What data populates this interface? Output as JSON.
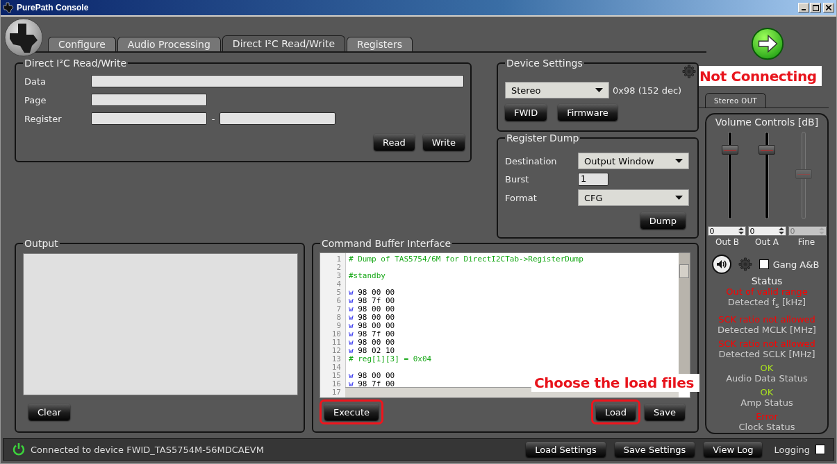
{
  "window": {
    "title": "PurePath Console"
  },
  "tabs": [
    {
      "label": "Configure",
      "selected": false
    },
    {
      "label": "Audio Processing",
      "selected": false
    },
    {
      "label": "Direct I²C Read/Write",
      "selected": true
    },
    {
      "label": "Registers",
      "selected": false
    }
  ],
  "direct_i2c": {
    "title": "Direct I²C Read/Write",
    "fields": [
      {
        "label": "Data",
        "kind": "wide"
      },
      {
        "label": "Page",
        "kind": "short"
      },
      {
        "label": "Register",
        "kind": "range"
      }
    ],
    "range_separator": "-",
    "buttons": [
      "Read",
      "Write"
    ]
  },
  "device_settings": {
    "title": "Device Settings",
    "mode": "Stereo",
    "address": "0x98 (152 dec)",
    "buttons": [
      "FWID",
      "Firmware"
    ]
  },
  "register_dump": {
    "title": "Register Dump",
    "rows": [
      {
        "label": "Destination",
        "kind": "dropdown",
        "value": "Output Window"
      },
      {
        "label": "Burst",
        "kind": "input",
        "value": "1"
      },
      {
        "label": "Format",
        "kind": "dropdown",
        "value": "CFG"
      }
    ],
    "button": "Dump"
  },
  "output": {
    "title": "Output",
    "button": "Clear"
  },
  "command_buffer": {
    "title": "Command Buffer Interface",
    "lines": [
      {
        "number": "1",
        "kind": "comment",
        "text": "# Dump of TAS5754/6M for DirectI2CTab->RegisterDump"
      },
      {
        "number": "2",
        "kind": "blank"
      },
      {
        "number": "3",
        "kind": "comment",
        "text": "#standby"
      },
      {
        "number": "4",
        "kind": "blank"
      },
      {
        "number": "5",
        "kind": "write",
        "op": "w",
        "text": "98 00 00"
      },
      {
        "number": "6",
        "kind": "write",
        "op": "w",
        "text": "98 7f 00"
      },
      {
        "number": "7",
        "kind": "write",
        "op": "w",
        "text": "98 00 00"
      },
      {
        "number": "8",
        "kind": "write",
        "op": "w",
        "text": "98 00 00"
      },
      {
        "number": "9",
        "kind": "write",
        "op": "w",
        "text": "98 00 00"
      },
      {
        "number": "10",
        "kind": "write",
        "op": "w",
        "text": "98 7f 00"
      },
      {
        "number": "11",
        "kind": "write",
        "op": "w",
        "text": "98 00 00"
      },
      {
        "number": "12",
        "kind": "write",
        "op": "w",
        "text": "98 02 10"
      },
      {
        "number": "13",
        "kind": "comment",
        "text": "# reg[1][3] = 0x04"
      },
      {
        "number": "14",
        "kind": "blank"
      },
      {
        "number": "15",
        "kind": "write",
        "op": "w",
        "text": "98 00 00"
      },
      {
        "number": "16",
        "kind": "write",
        "op": "w",
        "text": "98 7f 00"
      },
      {
        "number": "17",
        "kind": "blank"
      }
    ],
    "buttons": [
      {
        "label": "Execute",
        "highlighted": true
      },
      {
        "label": "Load",
        "highlighted": true
      },
      {
        "label": "Save",
        "highlighted": false
      }
    ],
    "annotation": "Choose the load files"
  },
  "connection": {
    "status": "Not Connecting"
  },
  "output_tab": {
    "label": "Stereo OUT",
    "selected": true
  },
  "volume": {
    "title": "Volume Controls [dB]",
    "channels": [
      {
        "name": "Out B",
        "value": "0",
        "level": 0.83,
        "disabled": false
      },
      {
        "name": "Out A",
        "value": "0",
        "level": 0.83,
        "disabled": false
      },
      {
        "name": "Fine",
        "value": "0",
        "level": 0.52,
        "disabled": true
      }
    ],
    "gang": {
      "label": "Gang A&B",
      "checked": false
    }
  },
  "status": {
    "title": "Status",
    "items": [
      {
        "value": "Out of valid range",
        "label": "Detected f$_{s}$ [kHz]",
        "color": "#ff0000"
      },
      {
        "value": "SCK ratio not allowed",
        "label": "Detected MCLK [MHz]",
        "color": "#ff0000"
      },
      {
        "value": "SCK ratio not allowed",
        "label": "Detected SCLK [MHz]",
        "color": "#ff0000"
      },
      {
        "value": "OK",
        "label": "Audio Data Status",
        "color": "#a8e020"
      },
      {
        "value": "OK",
        "label": "Amp Status",
        "color": "#a8e020"
      },
      {
        "value": "Error",
        "label": "Clock Status",
        "color": "#ff0000"
      }
    ]
  },
  "status_bar": {
    "message": "Connected to device FWID_TAS5754M-56MDCAEVM",
    "buttons": [
      "Load Settings",
      "Save Settings",
      "View Log"
    ],
    "logging": {
      "label": "Logging",
      "checked": false
    }
  }
}
